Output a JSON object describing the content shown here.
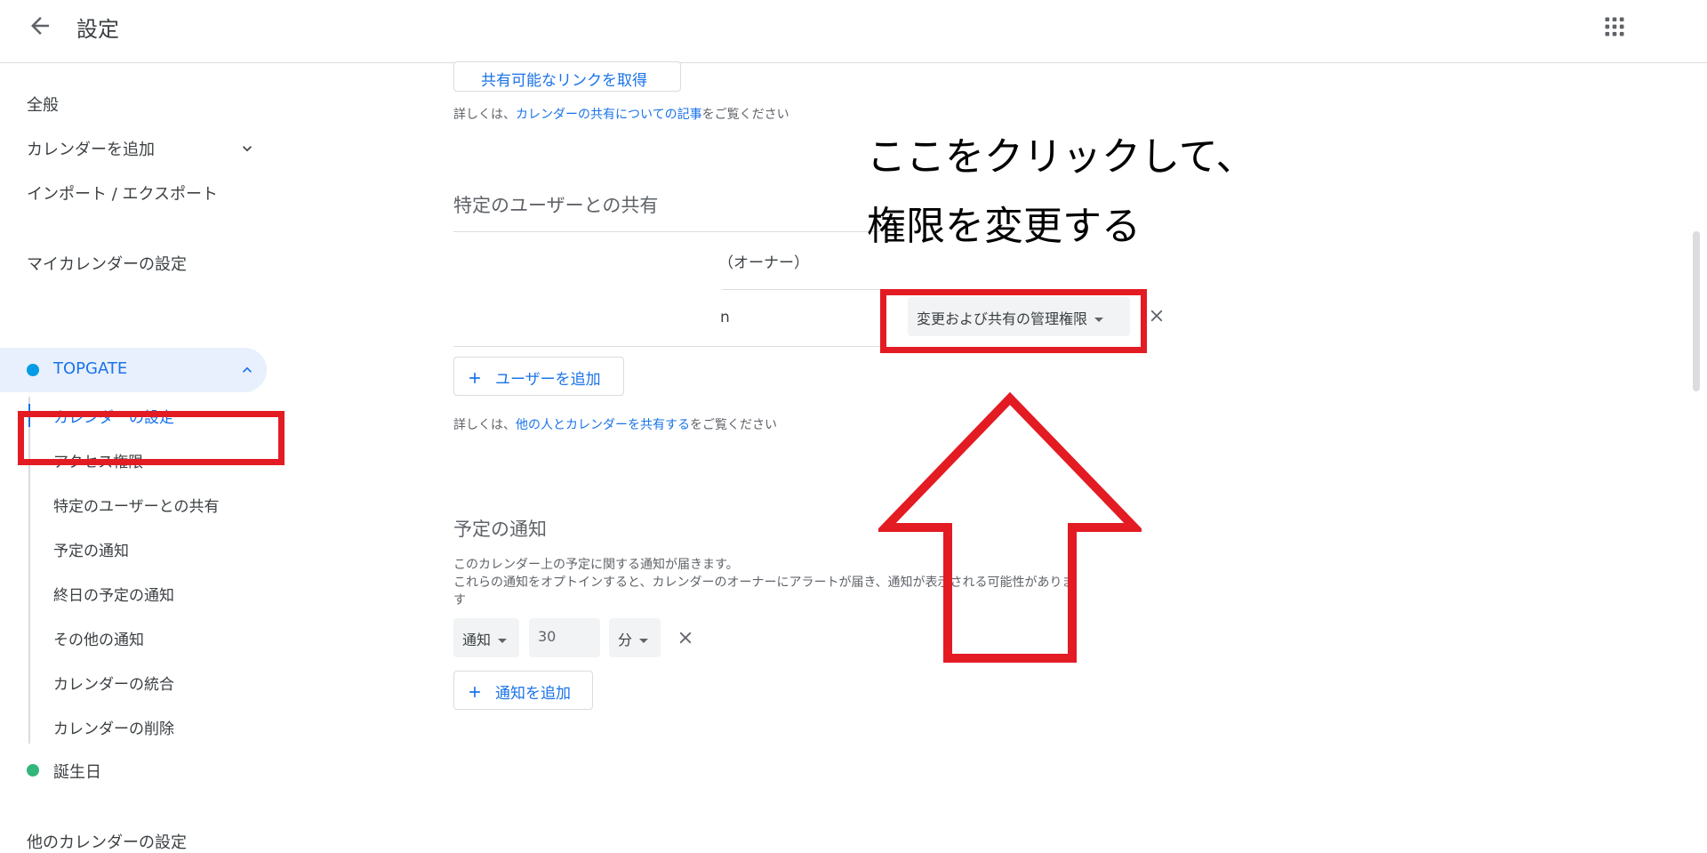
{
  "header": {
    "title": "設定",
    "back_icon": "arrow-left-icon",
    "apps_icon": "apps-grid-icon"
  },
  "sidebar": {
    "general": "全般",
    "add_calendar": "カレンダーを追加",
    "import_export": "インポート / エクスポート",
    "my_calendars_heading": "マイカレンダーの設定",
    "calendar": {
      "name": "TOPGATE",
      "color": "#039be5",
      "sub_items": [
        "カレンダーの設定",
        "アクセス権限",
        "特定のユーザーとの共有",
        "予定の通知",
        "終日の予定の通知",
        "その他の通知",
        "カレンダーの統合",
        "カレンダーの削除"
      ]
    },
    "birthday": {
      "name": "誕生日",
      "color": "#33b679"
    },
    "other_calendars_heading": "他のカレンダーの設定"
  },
  "main": {
    "get_link_button": "共有可能なリンクを取得",
    "learn_more_1_prefix": "詳しくは、",
    "learn_more_1_link": "カレンダーの共有についての記事",
    "learn_more_1_suffix": "をご覧ください",
    "share_section_title": "特定のユーザーとの共有",
    "owner_label": "（オーナー）",
    "user_row_text": "n",
    "permission_dropdown": "変更および共有の管理権限",
    "add_user_button": "ユーザーを追加",
    "learn_more_2_prefix": "詳しくは、",
    "learn_more_2_link": "他の人とカレンダーを共有する",
    "learn_more_2_suffix": "をご覧ください",
    "notify_section_title": "予定の通知",
    "notify_desc_1": "このカレンダー上の予定に関する通知が届きます。",
    "notify_desc_2": "これらの通知をオプトインすると、カレンダーのオーナーにアラートが届き、通知が表示される可能性がありま",
    "notify_desc_3": "す",
    "notify_type": "通知",
    "notify_value": "30",
    "notify_unit": "分",
    "add_notify_button": "通知を追加"
  },
  "annotation": {
    "line1": "ここをクリックして、",
    "line2": "権限を変更する",
    "color": "#e31b23"
  },
  "colors": {
    "accent": "#1a73e8",
    "selected_bg": "#e8f0fe"
  }
}
